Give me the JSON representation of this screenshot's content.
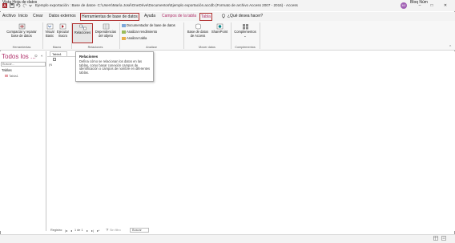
{
  "window": {
    "title": "Ejemplo exportación : Base de datos- C:\\Users\\María José\\OneDrive\\Documentos\\Ejemplo exportación.accdb (Formato de archivo Access 2007 - 2016) - Access",
    "user_initials": "MJ"
  },
  "menu": {
    "tabs": [
      "Archivo",
      "Inicio",
      "Crear",
      "Datos externos",
      "Herramientas de base de datos",
      "Ayuda",
      "Campos de la tabla",
      "Tabla"
    ],
    "search": "¿Qué desea hacer?"
  },
  "ribbon": {
    "compact_label": "Compactar y reparar base de datos",
    "visual_basic": "Visual Basic",
    "run_macro": "Ejecutar macro",
    "relations": "Relaciones",
    "object_dependencies": "Dependencias del objeto",
    "documenter": "Documentador de base de datos",
    "analyze_performance": "Analizar rendimiento",
    "analyze_table": "Analizar tabla",
    "access_database": "Base de datos de Access",
    "sharepoint": "SharePoint",
    "addins": "Complementos",
    "groups": {
      "tools": "Herramientas",
      "macro": "Macro",
      "relations": "Relaciones",
      "analyze": "Analizar",
      "move_data": "Mover datos",
      "addins": "Complementos"
    }
  },
  "nav": {
    "title": "Todos los ...",
    "search_placeholder": "Buscar...",
    "section": "Tablas",
    "item": "Tabla1"
  },
  "document": {
    "tab": "Tabla1",
    "row_marker": "(N"
  },
  "tooltip": {
    "title": "Relaciones",
    "body": "Defina cómo se relacionan los datos en las tablas, como basar conexión campos de identificación o campos de nombre en diferentes tablas."
  },
  "record_nav": {
    "label": "Registro:",
    "position": "1 de 1",
    "filter": "Sin filtro",
    "search": "Buscar"
  },
  "status": {
    "left": "Vista Hoja de datos",
    "right": "Bloq Núm"
  },
  "colors": {
    "accent": "#b03030",
    "pink": "#b0306a"
  }
}
